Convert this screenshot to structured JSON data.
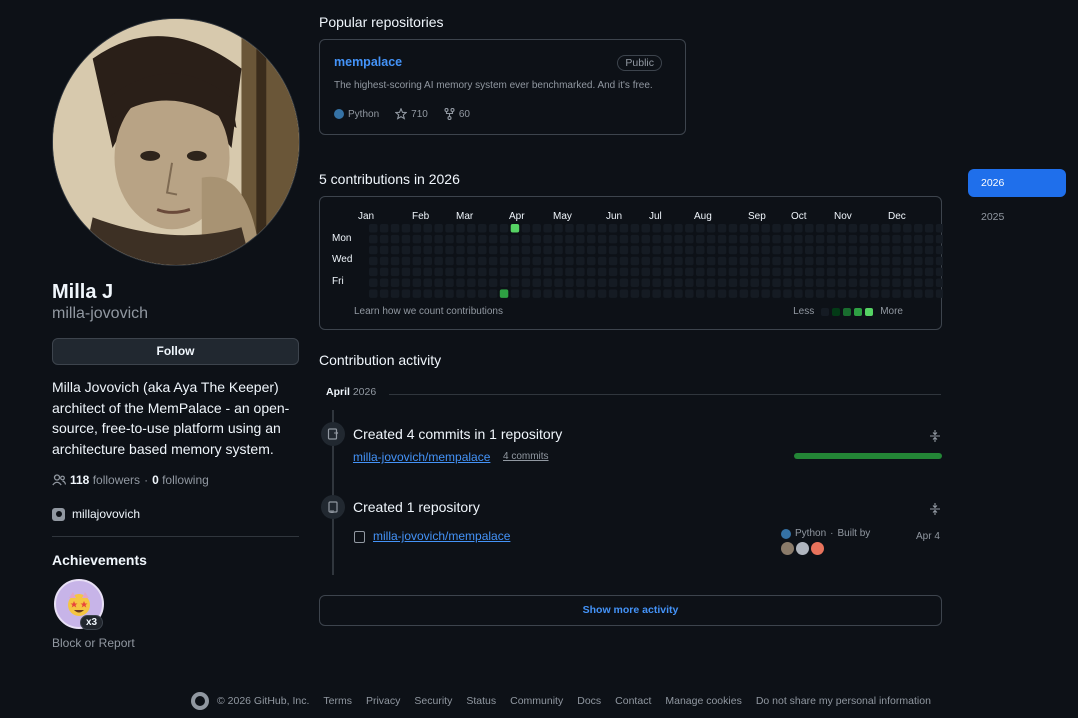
{
  "profile": {
    "display_name": "Milla J",
    "username": "milla-jovovich",
    "follow_label": "Follow",
    "bio": "Milla Jovovich (aka Aya The Keeper) architect of the MemPalace - an open-source, free-to-use platform using an architecture based memory system.",
    "followers_count": "118",
    "followers_label": "followers",
    "separator": "·",
    "following_count": "0",
    "following_label": "following",
    "instagram": "millajovovich",
    "achievements_title": "Achievements",
    "achievement_count": "x3",
    "block_report": "Block or Report"
  },
  "popular": {
    "title": "Popular repositories",
    "repo": {
      "name": "mempalace",
      "visibility": "Public",
      "description": "The highest-scoring AI memory system ever benchmarked. And it's free.",
      "language": "Python",
      "language_color": "#3572A5",
      "stars": "710",
      "forks": "60"
    }
  },
  "contributions": {
    "title": "5 contributions in 2026",
    "months": [
      "Jan",
      "Feb",
      "Mar",
      "Apr",
      "May",
      "Jun",
      "Jul",
      "Aug",
      "Sep",
      "Oct",
      "Nov",
      "Dec"
    ],
    "days": [
      "Mon",
      "Wed",
      "Fri"
    ],
    "learn_label": "Learn how we count contributions",
    "less_label": "Less",
    "more_label": "More",
    "weeks": 53,
    "active_cells": [
      {
        "week": 13,
        "day": 0,
        "level": 4
      },
      {
        "week": 12,
        "day": 6,
        "level": 3
      }
    ],
    "level_colors": [
      "#151b23",
      "#033a16",
      "#196c2e",
      "#2ea043",
      "#56d364"
    ]
  },
  "years": {
    "active": "2026",
    "other": "2025"
  },
  "activity": {
    "title": "Contribution activity",
    "month": "April",
    "year": "2026",
    "item1": {
      "title": "Created 4 commits in 1 repository",
      "repo": "milla-jovovich/mempalace",
      "commits": "4 commits",
      "progress": 1.0
    },
    "item2": {
      "title": "Created 1 repository",
      "repo": "milla-jovovich/mempalace",
      "language": "Python",
      "built_by": "Built by",
      "date": "Apr 4"
    },
    "show_more": "Show more activity"
  },
  "footer": {
    "copyright": "© 2026 GitHub, Inc.",
    "links": [
      "Terms",
      "Privacy",
      "Security",
      "Status",
      "Community",
      "Docs",
      "Contact",
      "Manage cookies",
      "Do not share my personal information"
    ]
  }
}
